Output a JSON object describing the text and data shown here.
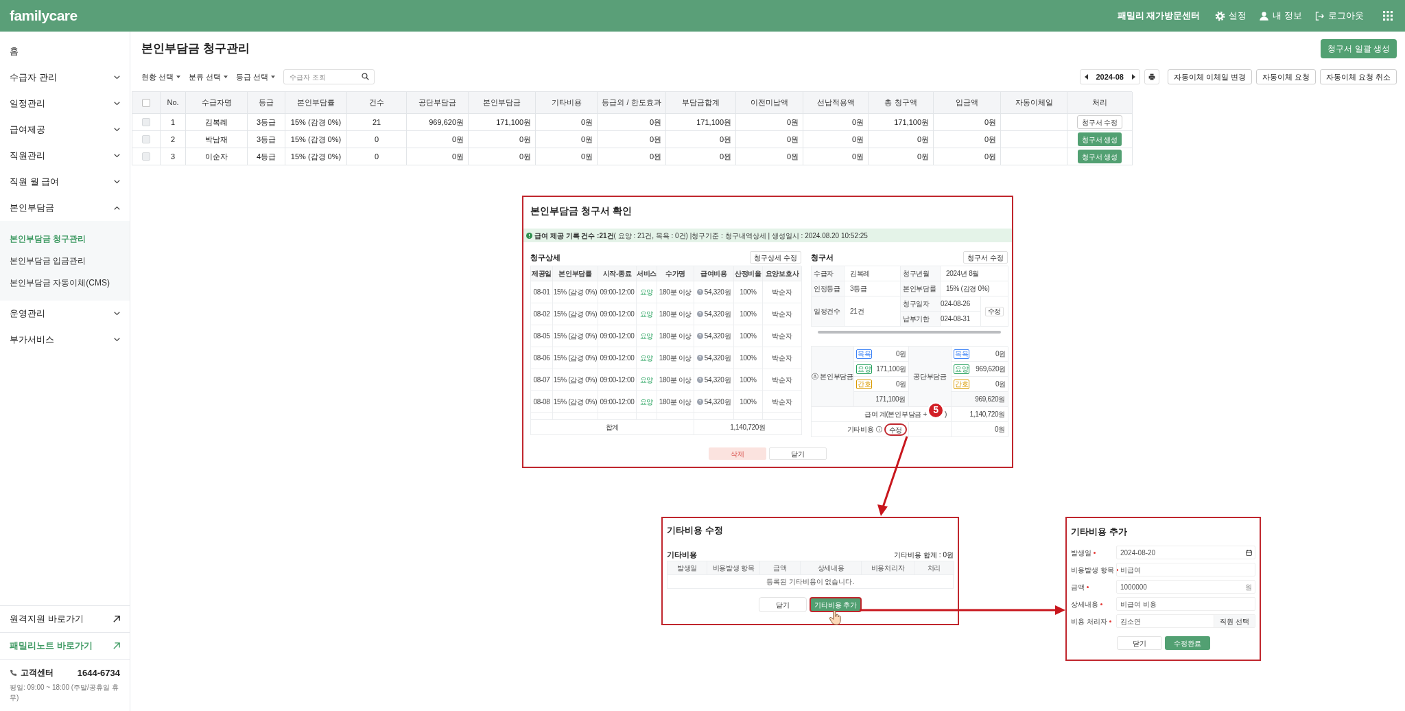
{
  "header": {
    "logo": "familycare",
    "center_name": "패밀리 재가방문센터",
    "links": [
      {
        "label": "설정"
      },
      {
        "label": "내 정보"
      },
      {
        "label": "로그아웃"
      }
    ]
  },
  "sidebar": {
    "items": [
      {
        "label": "홈",
        "kind": "link"
      },
      {
        "label": "수급자 관리",
        "kind": "group",
        "expanded": false
      },
      {
        "label": "일정관리",
        "kind": "group",
        "expanded": false
      },
      {
        "label": "급여제공",
        "kind": "group",
        "expanded": false
      },
      {
        "label": "직원관리",
        "kind": "group",
        "expanded": false
      },
      {
        "label": "직원 월 급여",
        "kind": "group",
        "expanded": false
      },
      {
        "label": "본인부담금",
        "kind": "group",
        "expanded": true,
        "children": [
          {
            "label": "본인부담금 청구관리",
            "selected": true
          },
          {
            "label": "본인부담금 입금관리",
            "selected": false
          },
          {
            "label": "본인부담금 자동이체(CMS)",
            "selected": false
          }
        ]
      },
      {
        "label": "운영관리",
        "kind": "group",
        "expanded": false
      },
      {
        "label": "부가서비스",
        "kind": "group",
        "expanded": false
      }
    ],
    "shortcuts": [
      {
        "label": "원격지원 바로가기",
        "highlighted": false
      },
      {
        "label": "패밀리노트 바로가기",
        "highlighted": true
      }
    ],
    "support": {
      "label": "고객센터",
      "phone": "1644-6734",
      "hours": "평일: 09:00 ~ 18:00 (주말/공휴일 휴무)"
    }
  },
  "page": {
    "title": "본인부담금 청구관리",
    "primary_button": "청구서 일괄 생성"
  },
  "filters": [
    "현황 선택",
    "분류 선택",
    "등급 선택"
  ],
  "search": {
    "placeholder": "수급자 조회"
  },
  "month": "2024-08",
  "actions": [
    "자동이체 이체일 변경",
    "자동이체 요청",
    "자동이체 요청 취소"
  ],
  "table": {
    "select_all": {
      "checked": false
    },
    "columns": [
      "No.",
      "수급자명",
      "등급",
      "본인부담률",
      "건수",
      "공단부담금",
      "본인부담금",
      "기타비용",
      "등급외 / 한도효과",
      "부담금합계",
      "이전미납액",
      "선납적용액",
      "총 청구액",
      "입금액",
      "자동이체일",
      "처리"
    ],
    "rows": [
      {
        "checked": false,
        "disabled": true,
        "cells": [
          "1",
          "김복례",
          "3등급",
          "15% (감경 0%)",
          "21",
          "969,620원",
          "171,100원",
          "0원",
          "0원",
          "171,100원",
          "0원",
          "0원",
          "171,100원",
          "0원"
        ],
        "action": {
          "label": "청구서 수정",
          "kind": "edit"
        }
      },
      {
        "checked": false,
        "disabled": true,
        "cells": [
          "2",
          "박남재",
          "3등급",
          "15% (감경 0%)",
          "0",
          "0원",
          "0원",
          "0원",
          "0원",
          "0원",
          "0원",
          "0원",
          "0원",
          "0원"
        ],
        "action": {
          "label": "청구서 생성",
          "kind": "create"
        }
      },
      {
        "checked": false,
        "disabled": true,
        "cells": [
          "3",
          "이순자",
          "4등급",
          "15% (감경 0%)",
          "0",
          "0원",
          "0원",
          "0원",
          "0원",
          "0원",
          "0원",
          "0원",
          "0원",
          "0원"
        ],
        "action": {
          "label": "청구서 생성",
          "kind": "create"
        }
      }
    ]
  },
  "invoice_dialog": {
    "title": "본인부담금 청구서 확인",
    "notice": "**급여 제공 기록 건수 :21건**( 요양 : 21건, 목욕 : 0건) |청구기준 : 청구내역상세 | 생성일시 : 2024.08.20 10:52:25",
    "detail": {
      "title": "청구상세",
      "edit_button": "청구상세 수정",
      "columns": [
        "제공일",
        "본인부담률",
        "시작-종료",
        "서비스",
        "수가명",
        "급여비용",
        "산정비율",
        "요양보호사"
      ],
      "rows": [
        {
          "cells": [
            "08-01",
            "15% (감경 0%)",
            "09:00-12:00",
            "요양",
            "180분 이상",
            "54,320원",
            "100%",
            "박순자"
          ]
        },
        {
          "cells": [
            "08-02",
            "15% (감경 0%)",
            "09:00-12:00",
            "요양",
            "180분 이상",
            "54,320원",
            "100%",
            "박순자"
          ]
        },
        {
          "cells": [
            "08-05",
            "15% (감경 0%)",
            "09:00-12:00",
            "요양",
            "180분 이상",
            "54,320원",
            "100%",
            "박순자"
          ]
        },
        {
          "cells": [
            "08-06",
            "15% (감경 0%)",
            "09:00-12:00",
            "요양",
            "180분 이상",
            "54,320원",
            "100%",
            "박순자"
          ]
        },
        {
          "cells": [
            "08-07",
            "15% (감경 0%)",
            "09:00-12:00",
            "요양",
            "180분 이상",
            "54,320원",
            "100%",
            "박순자"
          ]
        },
        {
          "cells": [
            "08-08",
            "15% (감경 0%)",
            "09:00-12:00",
            "요양",
            "180분 이상",
            "54,320원",
            "100%",
            "박순자"
          ]
        }
      ],
      "total_label": "합계",
      "total_value": "1,140,720원"
    },
    "invoice": {
      "title": "청구서",
      "edit_button": "청구서 수정",
      "info": {
        "recipient_label": "수급자",
        "recipient": "김복례",
        "month_label": "청구년월",
        "month": "2024년 8월",
        "grade_label": "인정등급",
        "grade": "3등급",
        "rate_label": "본인부담률",
        "rate": "15% (감경 0%)",
        "count_label": "일정건수",
        "count": "21건",
        "bill_date_label": "청구일자",
        "bill_date": "024-08-26",
        "due_label": "납부기한",
        "due": "024-08-31",
        "edit_button": "수정"
      },
      "shares": [
        {
          "label": "Ⓐ 본인부담금",
          "items": [
            {
              "tag": "목욕",
              "color": "#3b82f6",
              "value": "0원"
            },
            {
              "tag": "요양",
              "color": "#22a05a",
              "value": "171,100원"
            },
            {
              "tag": "간호",
              "color": "#d99a00",
              "value": "0원"
            }
          ],
          "total": "171,100원"
        },
        {
          "label": "공단부담금",
          "items": [
            {
              "tag": "목욕",
              "color": "#3b82f6",
              "value": "0원"
            },
            {
              "tag": "요양",
              "color": "#22a05a",
              "value": "969,620원"
            },
            {
              "tag": "간호",
              "color": "#d99a00",
              "value": "0원"
            }
          ],
          "total": "969,620원"
        }
      ],
      "sum_row": {
        "label_before": "급여 계(본인부담금 +",
        "label_after": ")",
        "value": "1,140,720원"
      },
      "other_row": {
        "label": "기타비용",
        "button": "수정",
        "value": "0원"
      }
    },
    "step_badge": "5",
    "buttons": [
      {
        "label": "삭제",
        "kind": "danger"
      },
      {
        "label": "닫기",
        "kind": "plain"
      }
    ]
  },
  "other_cost_dialog": {
    "title": "기타비용 수정",
    "section": "기타비용",
    "sum": "기타비용 합계 : 0원",
    "columns": [
      "발생일",
      "비용발생 항목",
      "금액",
      "상세내용",
      "비용처리자",
      "처리"
    ],
    "empty": "등록된 기타비용이 없습니다.",
    "buttons": [
      {
        "label": "닫기",
        "kind": "plain"
      },
      {
        "label": "기타비용 추가",
        "kind": "primary"
      }
    ]
  },
  "add_cost_dialog": {
    "title": "기타비용 추가",
    "fields": [
      {
        "label": "발생일",
        "required": true,
        "value": "2024-08-20",
        "kind": "date"
      },
      {
        "label": "비용발생 항목",
        "required": true,
        "value": "비급여",
        "kind": "text"
      },
      {
        "label": "금액",
        "required": true,
        "value": "1000000",
        "kind": "amount",
        "unit": "원"
      },
      {
        "label": "상세내용",
        "required": true,
        "value": "비급여 비용",
        "kind": "text"
      },
      {
        "label": "비용 처리자",
        "required": true,
        "value": "김소연",
        "kind": "picker",
        "button": "직원 선택"
      }
    ],
    "buttons": [
      {
        "label": "닫기",
        "kind": "plain"
      },
      {
        "label": "수정완료",
        "kind": "primary"
      }
    ]
  }
}
